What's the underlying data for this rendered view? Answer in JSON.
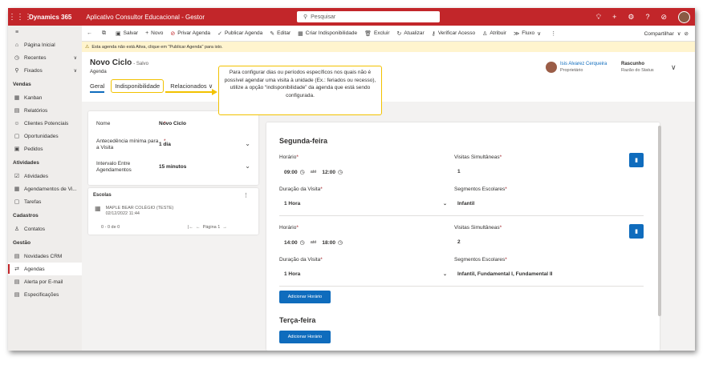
{
  "topbar": {
    "brand": "Dynamics 365",
    "app_name": "Aplicativo Consultor Educacional - Gestor",
    "search_placeholder": "Pesquisar"
  },
  "nav": {
    "items_top": [
      {
        "label": "Página Inicial",
        "icon": "home-icon"
      },
      {
        "label": "Recentes",
        "icon": "clock-icon"
      },
      {
        "label": "Fixados",
        "icon": "pin-icon"
      }
    ],
    "groups": [
      {
        "title": "Vendas",
        "items": [
          "Kanban",
          "Relatórios",
          "Clientes Potenciais",
          "Oportunidades",
          "Pedidos"
        ]
      },
      {
        "title": "Atividades",
        "items": [
          "Atividades",
          "Agendamentos de Vi...",
          "Tarefas"
        ]
      },
      {
        "title": "Cadastros",
        "items": [
          "Contatos"
        ]
      },
      {
        "title": "Gestão",
        "items": [
          "Novidades CRM",
          "Agendas",
          "Alerta por E-mail",
          "Especificações"
        ]
      }
    ]
  },
  "cmdbar": {
    "save": "Salvar",
    "new": "Novo",
    "private_schedule": "Privar Agenda",
    "publish_schedule": "Publicar Agenda",
    "edit": "Editar",
    "create_unavailability": "Criar Indisponibilidade",
    "delete": "Excluir",
    "refresh": "Atualizar",
    "check_access": "Verificar Acesso",
    "assign": "Atribuir",
    "flow": "Fluxo",
    "share": "Compartilhar"
  },
  "notification": "Esta agenda não está Ativa, clique em \"Publicar Agenda\" para isto.",
  "header": {
    "title": "Novo Ciclo",
    "saved": "- Salvo",
    "entity": "Agenda",
    "tabs": [
      "Geral",
      "Indisponibilidade",
      "Relacionados"
    ],
    "owner_name": "Isis Alvarez Cerqueira",
    "owner_label": "Proprietário",
    "status_value": "Rascunho",
    "status_label": "Razão do Status"
  },
  "callout": "Para configurar dias ou períodos específicos nos quais não é possível agendar uma visita à unidade (Ex.: feriados ou recesso), utilize a opção “indisponibilidade” da agenda que está sendo configurada.",
  "general": {
    "name_label": "Nome",
    "name_value": "Novo Ciclo",
    "advance_label": "Antecedência mínima para a Visita",
    "advance_value": "1 dia",
    "interval_label": "Intervalo Entre Agendamentos",
    "interval_value": "15 minutos"
  },
  "schools": {
    "title": "Escolas",
    "item_name": "MAPLE BEAR COLÉGIO (TESTE)",
    "item_date": "02/12/2022 11:44",
    "count": "0 - 0 de 0",
    "page": "Página 1"
  },
  "schedule": {
    "day1": "Segunda-feira",
    "day2": "Terça-feira",
    "labels": {
      "time": "Horário",
      "simultaneous": "Visitas Simultâneas",
      "duration": "Duração da Visita",
      "segments": "Segmentos Escolares",
      "until": "até",
      "add": "Adicionar Horário"
    },
    "slots": [
      {
        "start": "09:00",
        "end": "12:00",
        "simultaneous": "1",
        "duration": "1 Hora",
        "segments": "Infantil"
      },
      {
        "start": "14:00",
        "end": "18:00",
        "simultaneous": "2",
        "duration": "1 Hora",
        "segments": "Infantil, Fundamental I, Fundamental II"
      }
    ]
  },
  "colors": {
    "brand_red": "#c2262a",
    "accent_blue": "#0f6cbd",
    "callout_yellow": "#f2c200"
  }
}
